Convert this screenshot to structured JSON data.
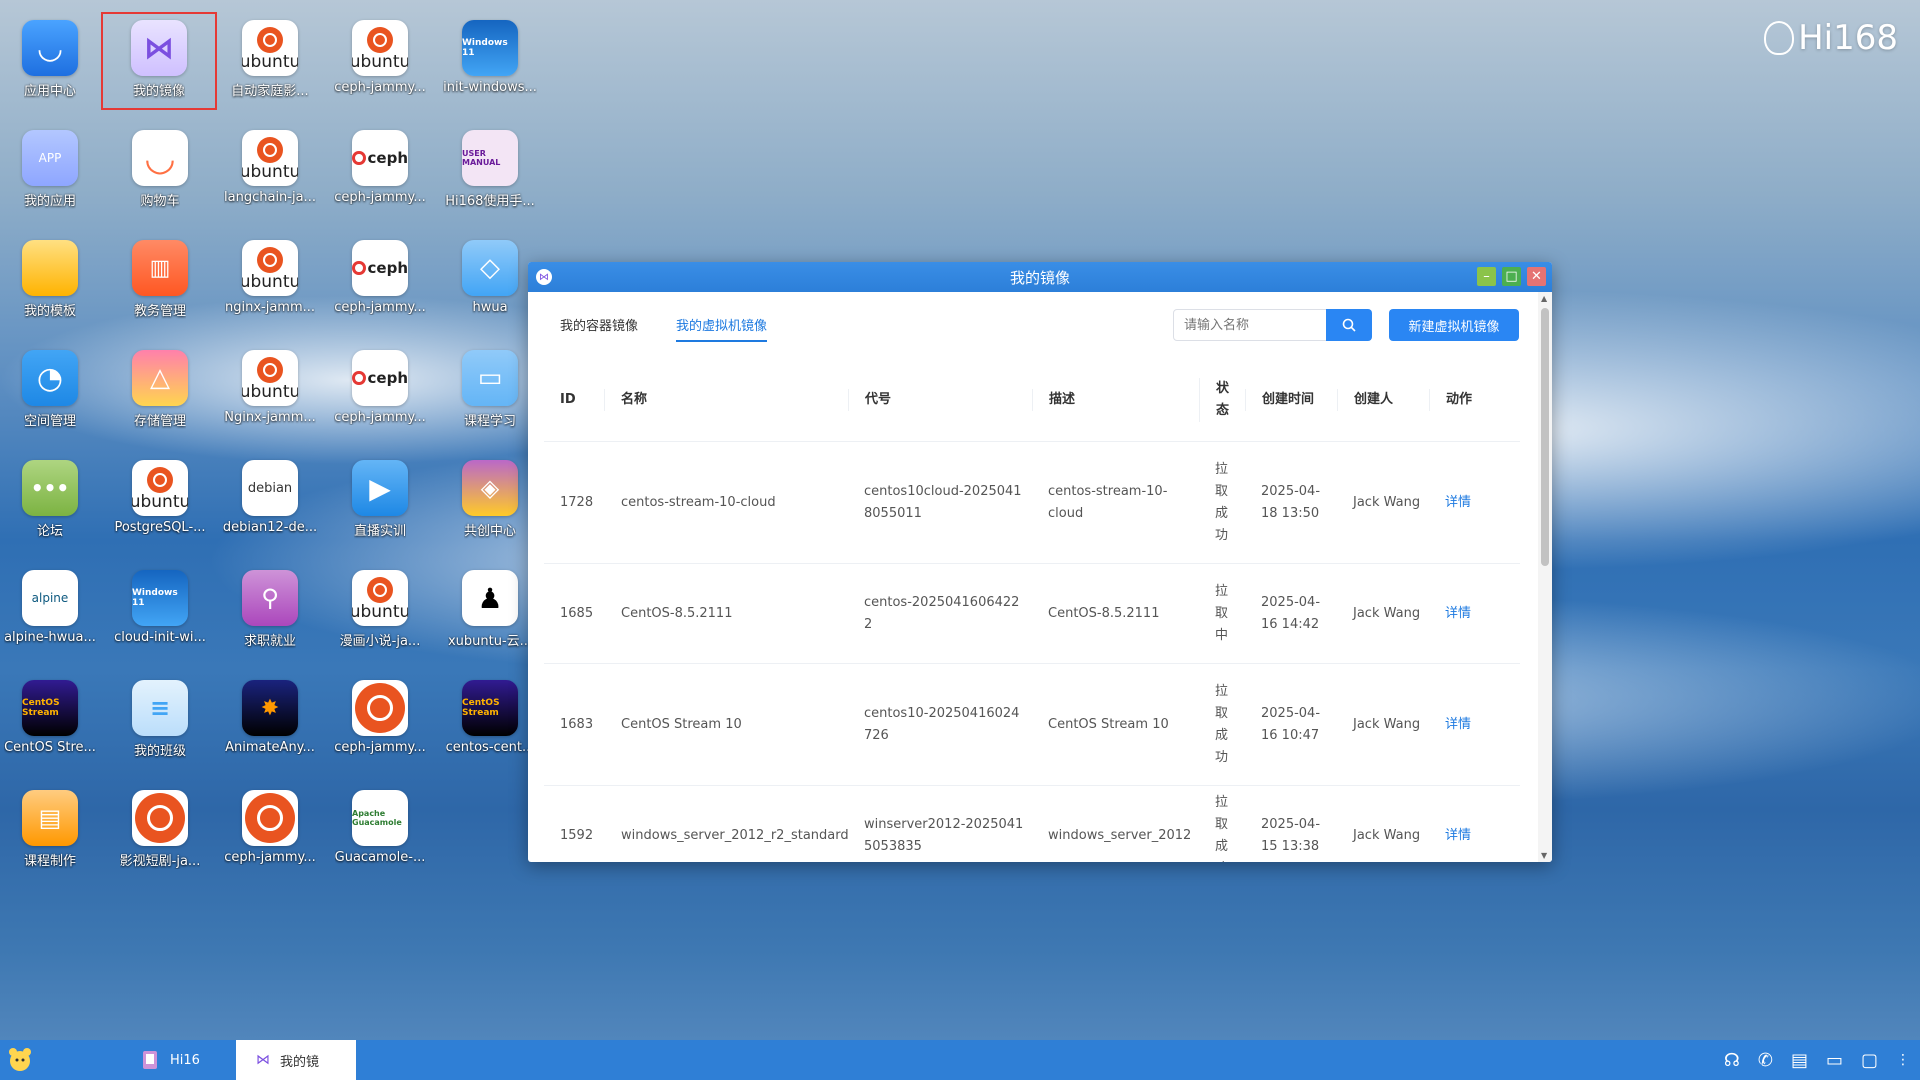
{
  "brand": "Hi168",
  "desktop_icons": [
    {
      "label": "应用中心",
      "icon": "app-store-icon"
    },
    {
      "label": "我的镜像",
      "icon": "my-images-icon"
    },
    {
      "label": "自动家庭影...",
      "icon": "ubuntu-icon"
    },
    {
      "label": "ceph-jammy...",
      "icon": "ubuntu-icon"
    },
    {
      "label": "init-windows...",
      "icon": "windows-icon"
    },
    {
      "label": "我的应用",
      "icon": "my-apps-icon"
    },
    {
      "label": "购物车",
      "icon": "cart-icon"
    },
    {
      "label": "langchain-ja...",
      "icon": "ubuntu-icon"
    },
    {
      "label": "ceph-jammy...",
      "icon": "ceph-icon"
    },
    {
      "label": "Hi168使用手...",
      "icon": "user-manual-icon"
    },
    {
      "label": "我的模板",
      "icon": "folder-icon"
    },
    {
      "label": "教务管理",
      "icon": "education-icon"
    },
    {
      "label": "nginx-jamm...",
      "icon": "ubuntu-icon"
    },
    {
      "label": "ceph-jammy...",
      "icon": "ceph-icon"
    },
    {
      "label": "hwua",
      "icon": "hwua-icon"
    },
    {
      "label": "空间管理",
      "icon": "space-icon"
    },
    {
      "label": "存储管理",
      "icon": "storage-icon"
    },
    {
      "label": "Nginx-jamm...",
      "icon": "ubuntu-icon"
    },
    {
      "label": "ceph-jammy...",
      "icon": "ceph-icon"
    },
    {
      "label": "课程学习",
      "icon": "course-icon"
    },
    {
      "label": "论坛",
      "icon": "forum-icon"
    },
    {
      "label": "PostgreSQL-...",
      "icon": "ubuntu-icon"
    },
    {
      "label": "debian12-de...",
      "icon": "debian-icon"
    },
    {
      "label": "直播实训",
      "icon": "live-icon"
    },
    {
      "label": "共创中心",
      "icon": "cocreate-icon"
    },
    {
      "label": "alpine-hwua...",
      "icon": "alpine-icon"
    },
    {
      "label": "cloud-init-wi...",
      "icon": "windows-icon"
    },
    {
      "label": "求职就业",
      "icon": "job-icon"
    },
    {
      "label": "漫画小说-ja...",
      "icon": "ubuntu-icon"
    },
    {
      "label": "xubuntu-云...",
      "icon": "linux-penguin-icon"
    },
    {
      "label": "CentOS Stre...",
      "icon": "centos-icon"
    },
    {
      "label": "我的班级",
      "icon": "class-icon"
    },
    {
      "label": "AnimateAny...",
      "icon": "animate-icon"
    },
    {
      "label": "ceph-jammy...",
      "icon": "ubuntu-icon"
    },
    {
      "label": "centos-cent...",
      "icon": "centos-icon"
    },
    {
      "label": "课程制作",
      "icon": "course-make-icon"
    },
    {
      "label": "影视短剧-ja...",
      "icon": "ubuntu-icon"
    },
    {
      "label": "ceph-jammy...",
      "icon": "ubuntu-icon"
    },
    {
      "label": "Guacamole-...",
      "icon": "guacamole-icon"
    }
  ],
  "window": {
    "title": "我的镜像",
    "tabs": [
      "我的容器镜像",
      "我的虚拟机镜像"
    ],
    "active_tab": "我的虚拟机镜像",
    "search_placeholder": "请输入名称",
    "new_button": "新建虚拟机镜像",
    "columns": [
      "ID",
      "名称",
      "代号",
      "描述",
      "状态",
      "创建时间",
      "创建人",
      "动作"
    ],
    "rows": [
      {
        "id": "1728",
        "name": "centos-stream-10-cloud",
        "code": "centos10cloud-20250418055011",
        "desc": "centos-stream-10-cloud",
        "status": "拉取成功",
        "time": "2025-04-18 13:50",
        "user": "Jack Wang",
        "action": "详情"
      },
      {
        "id": "1685",
        "name": "CentOS-8.5.2111",
        "code": "centos-20250416064222",
        "desc": "CentOS-8.5.2111",
        "status": "拉取中",
        "time": "2025-04-16 14:42",
        "user": "Jack Wang",
        "action": "详情"
      },
      {
        "id": "1683",
        "name": "CentOS Stream 10",
        "code": "centos10-20250416024726",
        "desc": "CentOS Stream 10",
        "status": "拉取成功",
        "time": "2025-04-16 10:47",
        "user": "Jack Wang",
        "action": "详情"
      },
      {
        "id": "1592",
        "name": "windows_server_2012_r2_standard",
        "code": "winserver2012-20250415053835",
        "desc": "windows_server_2012",
        "status": "拉取成功",
        "time": "2025-04-15 13:38",
        "user": "Jack Wang",
        "action": "详情"
      }
    ]
  },
  "taskbar": {
    "items": [
      {
        "label": "Hi16",
        "active": false
      },
      {
        "label": "我的镜",
        "active": true
      }
    ]
  },
  "colors": {
    "accent": "#2a86f3",
    "titlebar": "#2c7fd9",
    "taskbar": "#2f7fd6"
  }
}
